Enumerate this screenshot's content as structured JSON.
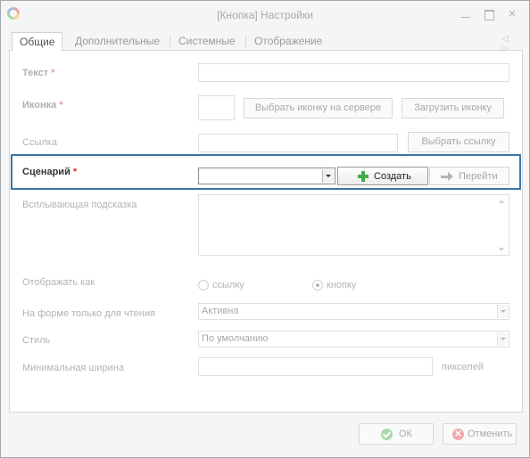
{
  "window": {
    "title": "[Кнопка] Настройки",
    "close_glyph": "×"
  },
  "tabs": [
    {
      "label": "Общие",
      "active": true
    },
    {
      "label": "Дополнительные",
      "active": false
    },
    {
      "label": "Системные",
      "active": false
    },
    {
      "label": "Отображение",
      "active": false
    }
  ],
  "tab_scroll_glyphs": "◁ ▷",
  "form": {
    "text_label": "Текст",
    "icon_label": "Иконка",
    "link_label": "Ссылка",
    "scenario_label": "Сценарий",
    "required_mark": "*",
    "tooltip_label": "Всплывающая подсказка",
    "display_as_label": "Отображать как",
    "readonly_label": "На форме только для чтения",
    "style_label": "Стиль",
    "min_width_label": "Минимальная ширина",
    "text_value": "",
    "link_value": "",
    "tooltip_value": "",
    "min_width_value": "",
    "min_width_unit": "пикселей"
  },
  "buttons": {
    "choose_icon_server": "Выбрать иконку на сервере",
    "upload_icon": "Загрузить иконку",
    "choose_link": "Выбрать ссылку",
    "create": "Создать",
    "goto": "Перейти",
    "ok": "ОК",
    "cancel": "Отменить",
    "cancel_glyph": "✕"
  },
  "display_as": {
    "options": [
      "ссылку",
      "кнопку"
    ],
    "selected": "кнопку"
  },
  "readonly_select": {
    "value": "Активна"
  },
  "style_select": {
    "value": "По умолчанию"
  },
  "colors": {
    "highlight_border": "#3a77a9",
    "required_active": "#d62b2b",
    "create_icon": "#3fae49"
  },
  "icons": [
    "app-logo-icon",
    "minimize-icon",
    "maximize-icon",
    "close-icon",
    "tab-scroll-left-icon",
    "tab-scroll-right-icon",
    "plus-icon",
    "arrow-right-icon",
    "combo-dropdown-icon",
    "check-circle-icon",
    "cancel-circle-icon"
  ]
}
